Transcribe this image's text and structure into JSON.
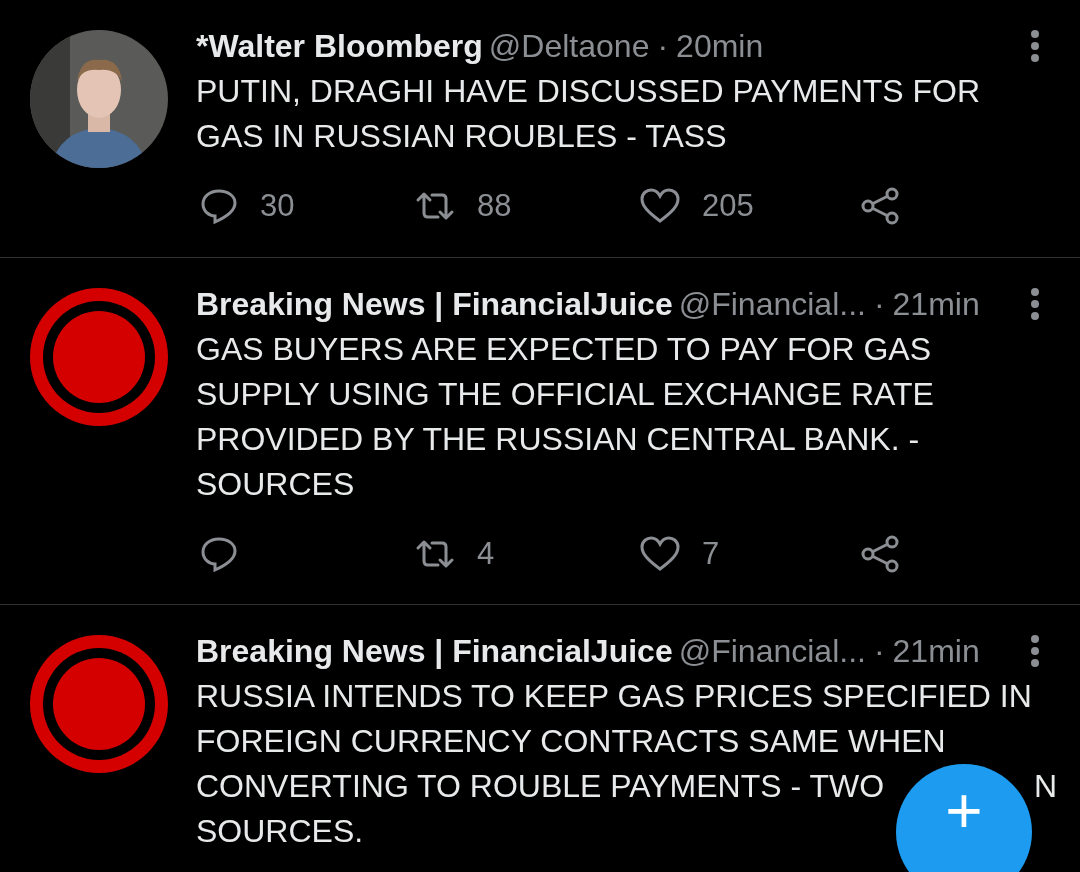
{
  "tweets": [
    {
      "name": "*Walter Bloomberg",
      "handle": "@Deltaone",
      "separator": "·",
      "time": "20min",
      "body": "PUTIN, DRAGHI HAVE DISCUSSED PAYMENTS FOR GAS IN RUSSIAN ROUBLES - TASS",
      "replies": "30",
      "retweets": "88",
      "likes": "205"
    },
    {
      "name": "Breaking News | FinancialJuice",
      "handle": "@Financial...",
      "separator": "·",
      "time": "21min",
      "avatar": {
        "kind": "logo"
      },
      "body": "GAS BUYERS ARE EXPECTED TO PAY FOR GAS SUPPLY USING THE OFFICIAL EXCHANGE RATE PROVIDED BY THE RUSSIAN CENTRAL BANK. - SOURCES",
      "retweets": "4",
      "likes": "7"
    },
    {
      "name": "Breaking News | FinancialJuice",
      "handle": "@Financial...",
      "separator": "·",
      "time": "21min",
      "avatar": {
        "kind": "logo"
      },
      "body": "RUSSIA INTENDS TO KEEP GAS PRICES SPECIFIED IN FOREIGN CURRENCY CONTRACTS SAME WHEN CONVERTING TO ROUBLE PAYMENTS - TWO",
      "body_after_cover": [
        "N",
        "SOURCES."
      ]
    }
  ],
  "compose_button": {
    "label": "+"
  }
}
